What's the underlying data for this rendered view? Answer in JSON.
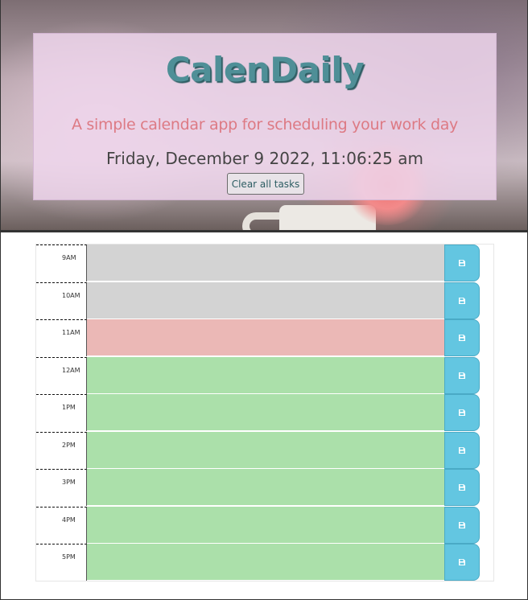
{
  "header": {
    "title": "CalenDaily",
    "subtitle": "A simple calendar app for scheduling your work day",
    "datetime": "Friday, December 9 2022, 11:06:25 am",
    "clear_label": "Clear all tasks"
  },
  "schedule": {
    "rows": [
      {
        "hour": "9AM",
        "task": "",
        "status": "past"
      },
      {
        "hour": "10AM",
        "task": "",
        "status": "past"
      },
      {
        "hour": "11AM",
        "task": "",
        "status": "present"
      },
      {
        "hour": "12AM",
        "task": "",
        "status": "future"
      },
      {
        "hour": "1PM",
        "task": "",
        "status": "future"
      },
      {
        "hour": "2PM",
        "task": "",
        "status": "future"
      },
      {
        "hour": "3PM",
        "task": "",
        "status": "future"
      },
      {
        "hour": "4PM",
        "task": "",
        "status": "future"
      },
      {
        "hour": "5PM",
        "task": "",
        "status": "future"
      }
    ],
    "save_icon": "floppy-disk-icon"
  },
  "colors": {
    "past": "#d3d3d3",
    "present": "#ebb8b6",
    "future": "#abe0aa",
    "save": "#63c6e1",
    "title": "#4f8f97",
    "subtitle": "#dd7a84"
  }
}
